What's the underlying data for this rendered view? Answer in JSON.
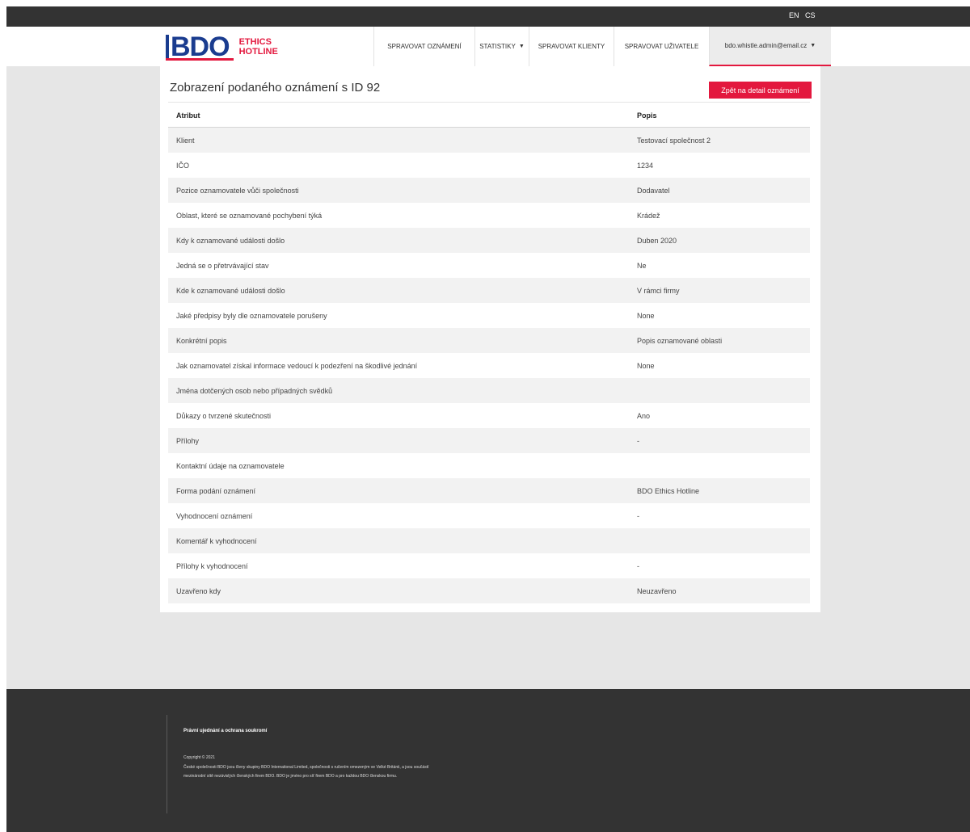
{
  "topbar": {
    "lang_en": "EN",
    "lang_cs": "CS"
  },
  "logo": {
    "brand": "BDO",
    "line1": "ETHICS",
    "line2": "HOTLINE"
  },
  "nav": {
    "manage_reports": "SPRAVOVAT OZNÁMENÍ",
    "statistics": "STATISTIKY",
    "manage_clients": "SPRAVOVAT KLIENTY",
    "manage_users": "SPRAVOVAT UŽIVATELE",
    "user_email": "bdo.whistle.admin@email.cz"
  },
  "page": {
    "title": "Zobrazení podaného oznámení s ID 92",
    "back_button": "Zpět na detail oznámení"
  },
  "table": {
    "headers": {
      "attribute": "Atribut",
      "description": "Popis"
    },
    "rows": [
      {
        "attribute": "Klient",
        "value": "Testovací společnost 2"
      },
      {
        "attribute": "IČO",
        "value": "1234"
      },
      {
        "attribute": "Pozice oznamovatele vůči společnosti",
        "value": "Dodavatel"
      },
      {
        "attribute": "Oblast, které se oznamované pochybení týká",
        "value": "Krádež"
      },
      {
        "attribute": "Kdy k oznamované události došlo",
        "value": "Duben 2020"
      },
      {
        "attribute": "Jedná se o přetrvávající stav",
        "value": "Ne"
      },
      {
        "attribute": "Kde k oznamované události došlo",
        "value": "V rámci firmy"
      },
      {
        "attribute": "Jaké předpisy byly dle oznamovatele porušeny",
        "value": "None"
      },
      {
        "attribute": "Konkrétní popis",
        "value": "Popis oznamované oblasti"
      },
      {
        "attribute": "Jak oznamovatel získal informace vedoucí k podezření na škodlivé jednání",
        "value": "None"
      },
      {
        "attribute": "Jména dotčených osob nebo případných svědků",
        "value": ""
      },
      {
        "attribute": "Důkazy o tvrzené skutečnosti",
        "value": "Ano"
      },
      {
        "attribute": "Přílohy",
        "value": "-"
      },
      {
        "attribute": "Kontaktní údaje na oznamovatele",
        "value": ""
      },
      {
        "attribute": "Forma podání oznámení",
        "value": "BDO Ethics Hotline"
      },
      {
        "attribute": "Vyhodnocení oznámení",
        "value": "-"
      },
      {
        "attribute": "Komentář k vyhodnocení",
        "value": ""
      },
      {
        "attribute": "Přílohy k vyhodnocení",
        "value": "-"
      },
      {
        "attribute": "Uzavřeno kdy",
        "value": "Neuzavřeno"
      }
    ]
  },
  "footer": {
    "legal_link": "Právní ujednání a ochrana soukromí",
    "copyright": "Copyright © 2021",
    "text": "České společnosti BDO jsou členy skupiny BDO International Limited, společnosti s ručením omezeným ve Velké Británii, a jsou součástí mezinárodní sítě nezávislých členských firem BDO. BDO je jméno pro síť firem BDO a pro každou BDO členskou firmu."
  },
  "colors": {
    "accent": "#e3183e",
    "brand_blue": "#1a3c8f",
    "dark_bar": "#333333",
    "page_bg": "#e6e6e6"
  }
}
